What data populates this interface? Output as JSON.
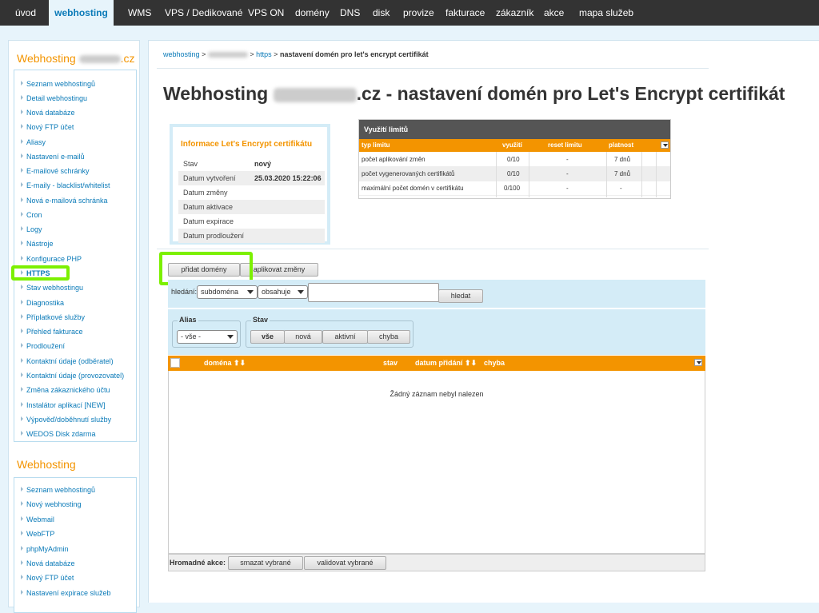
{
  "topnav": {
    "items": [
      "úvod",
      "webhosting",
      "WMS",
      "VPS / Dedikované",
      "VPS ON",
      "domény",
      "DNS",
      "disk",
      "provize",
      "fakturace",
      "zákazník",
      "akce",
      "mapa služeb"
    ]
  },
  "sidebar": {
    "section1_title_prefix": "Webhosting",
    "section1_title_suffix": ".cz",
    "section1_items": [
      "Seznam webhostingů",
      "Detail webhostingu",
      "Nová databáze",
      "Nový FTP účet",
      "Aliasy",
      "Nastavení e-mailů",
      "E-mailové schránky",
      "E-maily - blacklist/whitelist",
      "Nová e-mailová schránka",
      "Cron",
      "Logy",
      "Nástroje",
      "Konfigurace PHP",
      "HTTPS",
      "Stav webhostingu",
      "Diagnostika",
      "Příplatkové služby",
      "Přehled fakturace",
      "Prodloužení",
      "Kontaktní údaje (odběratel)",
      "Kontaktní údaje (provozovatel)",
      "Změna zákaznického účtu",
      "Instalátor aplikací [NEW]",
      "Výpověď/doběhnutí služby",
      "WEDOS Disk zdarma"
    ],
    "section2_title": "Webhosting",
    "section2_items": [
      "Seznam webhostingů",
      "Nový webhosting",
      "Webmail",
      "WebFTP",
      "phpMyAdmin",
      "Nová databáze",
      "Nový FTP účet",
      "Nastavení expirace služeb"
    ]
  },
  "breadcrumb": {
    "webhosting": "webhosting",
    "sep": ">",
    "https": "https",
    "current": "nastavení domén pro let's encrypt certifikát"
  },
  "title": {
    "prefix": "Webhosting",
    "suffix": ".cz - nastavení domén pro Let's Encrypt certifikát"
  },
  "info_box": {
    "title": "Informace Let's Encrypt certifikátu",
    "rows": [
      {
        "label": "Stav",
        "value": "nový"
      },
      {
        "label": "Datum vytvoření",
        "value": "25.03.2020 15:22:06"
      },
      {
        "label": "Datum změny",
        "value": ""
      },
      {
        "label": "Datum aktivace",
        "value": ""
      },
      {
        "label": "Datum expirace",
        "value": ""
      },
      {
        "label": "Datum prodloužení",
        "value": ""
      }
    ]
  },
  "limits": {
    "title": "Využití limitů",
    "columns": [
      "typ limitu",
      "využití",
      "reset limitu",
      "platnost"
    ],
    "rows": [
      {
        "type": "počet aplikování změn",
        "usage": "0/10",
        "reset": "-",
        "validity": "7 dnů"
      },
      {
        "type": "počet vygenerovaných certifikátů",
        "usage": "0/10",
        "reset": "-",
        "validity": "7 dnů"
      },
      {
        "type": "maximální počet domén v certifikátu",
        "usage": "0/100",
        "reset": "-",
        "validity": "-"
      }
    ]
  },
  "actions": {
    "add_domains": "přidat domény",
    "apply_changes": "aplikovat změny"
  },
  "search": {
    "label": "hledání:",
    "field_value": "subdoména",
    "operator_value": "obsahuje",
    "query_value": "",
    "button": "hledat"
  },
  "filters": {
    "alias_legend": "Alias",
    "alias_value": "- vše -",
    "stav_legend": "Stav",
    "stav_buttons": [
      "vše",
      "nová",
      "aktivní",
      "chyba"
    ]
  },
  "grid": {
    "columns": [
      "doména",
      "stav",
      "datum přidání",
      "chyba"
    ],
    "empty_message": "Žádný záznam nebyl nalezen"
  },
  "bulk": {
    "label": "Hromadné akce:",
    "delete_selected": "smazat vybrané",
    "validate_selected": "validovat vybrané"
  }
}
